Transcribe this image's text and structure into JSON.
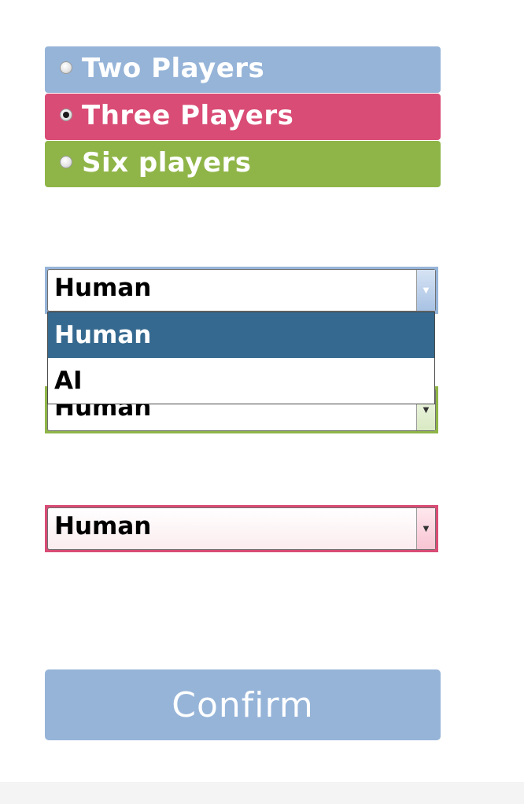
{
  "player_count": {
    "options": [
      {
        "label": "Two Players",
        "selected": false,
        "color": "#96b4d8"
      },
      {
        "label": "Three Players",
        "selected": true,
        "color": "#d94c75"
      },
      {
        "label": "Six players",
        "selected": false,
        "color": "#8fb548"
      }
    ]
  },
  "player_selects": [
    {
      "value": "Human",
      "color": "#96b4d8",
      "open": true
    },
    {
      "value": "Human",
      "color": "#8fb548",
      "open": false
    },
    {
      "value": "Human",
      "color": "#d94c75",
      "open": false
    }
  ],
  "dropdown": {
    "options": [
      "Human",
      "AI"
    ],
    "highlighted": "Human"
  },
  "confirm": {
    "label": "Confirm",
    "color": "#96b4d8"
  },
  "icons": {
    "select_arrow": "chevron-down-icon",
    "radio": "radio-icon"
  }
}
